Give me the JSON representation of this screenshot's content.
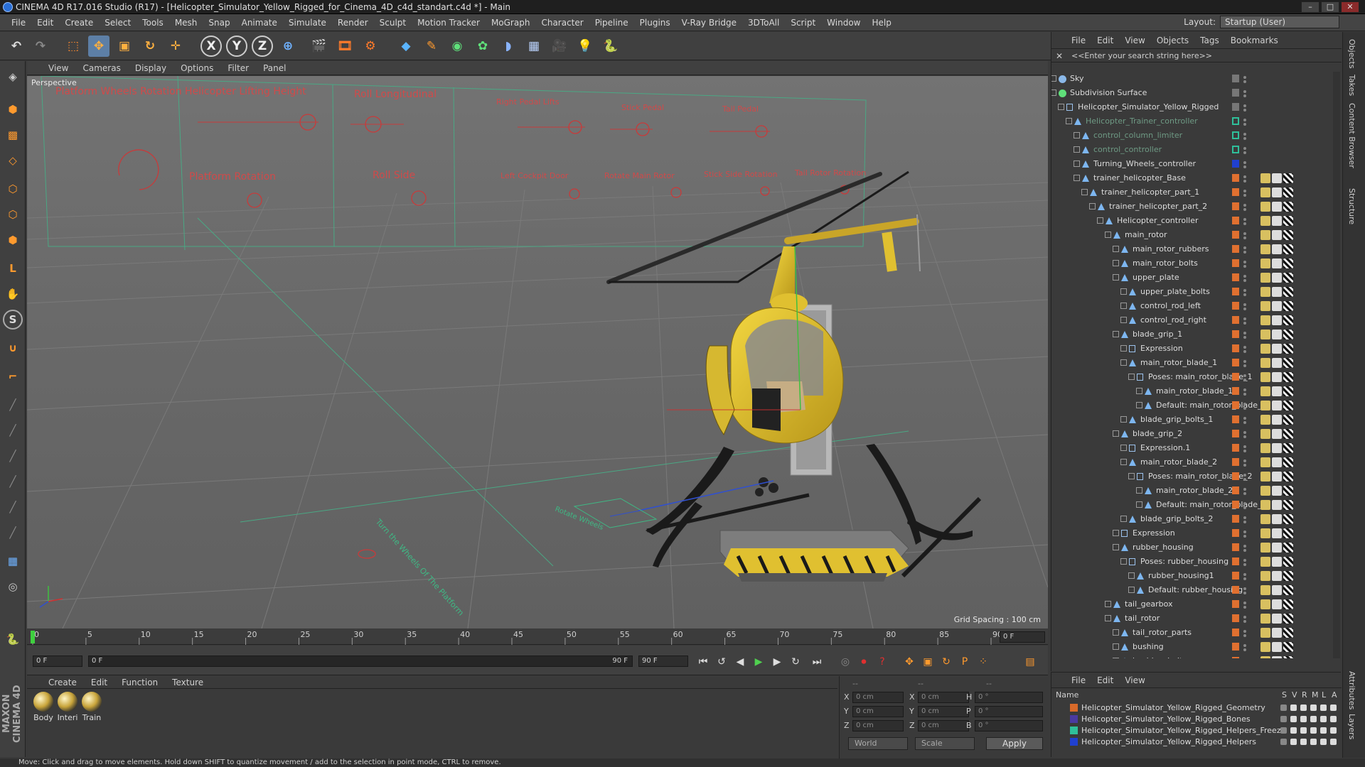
{
  "window": {
    "title": "CINEMA 4D R17.016 Studio (R17) - [Helicopter_Simulator_Yellow_Rigged_for_Cinema_4D_c4d_standart.c4d *] - Main"
  },
  "menu": [
    "File",
    "Edit",
    "Create",
    "Select",
    "Tools",
    "Mesh",
    "Snap",
    "Animate",
    "Simulate",
    "Render",
    "Sculpt",
    "Motion Tracker",
    "MoGraph",
    "Character",
    "Pipeline",
    "Plugins",
    "V-Ray Bridge",
    "3DToAll",
    "Script",
    "Window",
    "Help"
  ],
  "layout": {
    "label": "Layout:",
    "value": "Startup (User)"
  },
  "toolbar": {
    "axis_x": "X",
    "axis_y": "Y",
    "axis_z": "Z"
  },
  "viewport": {
    "menu": [
      "View",
      "Cameras",
      "Display",
      "Options",
      "Filter",
      "Panel"
    ],
    "label": "Perspective",
    "grid_spacing": "Grid Spacing : 100 cm",
    "hud": {
      "platform_wheels_rotation": "Platform Wheels Rotation",
      "lifting_height": "Helicopter Lifting Height",
      "roll_longitudinal": "Roll Longitudinal",
      "right_pedal": "Right Pedal Lifts",
      "stick_pedal": "Stick Pedal",
      "tail_pedal": "Tail Pedal",
      "platform_rotation": "Platform Rotation",
      "roll_side": "Roll Side",
      "left_cockpit_door": "Left Cockpit Door",
      "right_cockpit_door": "Rotate Main Rotor",
      "stick_side_rotation": "Stick Side Rotation",
      "tail_rotor_rotation": "Tail Rotor Rotation",
      "turn_wheels": "Turn the Wheels Of The Platform",
      "control_wheels": "Rotate Wheels"
    }
  },
  "timeline": {
    "ticks": [
      "0",
      "5",
      "10",
      "15",
      "20",
      "25",
      "30",
      "35",
      "40",
      "45",
      "50",
      "55",
      "60",
      "65",
      "70",
      "75",
      "80",
      "85",
      "90"
    ],
    "current_frame_right": "0 F"
  },
  "playback": {
    "start": "0 F",
    "slider_start": "0 F",
    "slider_end": "90 F",
    "end": "90 F"
  },
  "materials": {
    "menu": [
      "Create",
      "Edit",
      "Function",
      "Texture"
    ],
    "items": [
      "Body",
      "Interi",
      "Train"
    ]
  },
  "coords": {
    "header": "--",
    "rows": [
      {
        "a_label": "X",
        "a_val": "0 cm",
        "b_label": "X",
        "b_val": "0 cm",
        "c_label": "H",
        "c_val": "0 °"
      },
      {
        "a_label": "Y",
        "a_val": "0 cm",
        "b_label": "Y",
        "b_val": "0 cm",
        "c_label": "P",
        "c_val": "0 °"
      },
      {
        "a_label": "Z",
        "a_val": "0 cm",
        "b_label": "Z",
        "b_val": "0 cm",
        "c_label": "B",
        "c_val": "0 °"
      }
    ],
    "world": "World",
    "scale": "Scale",
    "apply": "Apply"
  },
  "status": "Move: Click and drag to move elements. Hold down SHIFT to quantize movement / add to the selection in point mode, CTRL to remove.",
  "objects": {
    "menu": [
      "File",
      "Edit",
      "View",
      "Objects",
      "Tags",
      "Bookmarks"
    ],
    "search": "<<Enter your search string here>>",
    "tree": [
      {
        "label": "Sky",
        "depth": 0,
        "icon": "sky-icon"
      },
      {
        "label": "Subdivision Surface",
        "depth": 0,
        "icon": "subdivision-icon"
      },
      {
        "label": "Helicopter_Simulator_Yellow_Rigged",
        "depth": 1,
        "icon": "null-icon"
      },
      {
        "label": "Helicopter_Trainer_controller",
        "depth": 2,
        "icon": "joint-icon",
        "dim": true
      },
      {
        "label": "control_column_limiter",
        "depth": 3,
        "icon": "joint-icon",
        "dim": true
      },
      {
        "label": "control_controller",
        "depth": 3,
        "icon": "joint-icon",
        "dim": true
      },
      {
        "label": "Turning_Wheels_controller",
        "depth": 3,
        "icon": "joint-icon"
      },
      {
        "label": "trainer_helicopter_Base",
        "depth": 3,
        "icon": "joint-icon"
      },
      {
        "label": "trainer_helicopter_part_1",
        "depth": 4,
        "icon": "joint-icon"
      },
      {
        "label": "trainer_helicopter_part_2",
        "depth": 5,
        "icon": "joint-icon"
      },
      {
        "label": "Helicopter_controller",
        "depth": 6,
        "icon": "joint-icon"
      },
      {
        "label": "main_rotor",
        "depth": 7,
        "icon": "joint-icon"
      },
      {
        "label": "main_rotor_rubbers",
        "depth": 8,
        "icon": "joint-icon"
      },
      {
        "label": "main_rotor_bolts",
        "depth": 8,
        "icon": "joint-icon"
      },
      {
        "label": "upper_plate",
        "depth": 8,
        "icon": "joint-icon"
      },
      {
        "label": "upper_plate_bolts",
        "depth": 9,
        "icon": "joint-icon"
      },
      {
        "label": "control_rod_left",
        "depth": 9,
        "icon": "joint-icon"
      },
      {
        "label": "control_rod_right",
        "depth": 9,
        "icon": "joint-icon"
      },
      {
        "label": "blade_grip_1",
        "depth": 8,
        "icon": "joint-icon"
      },
      {
        "label": "Expression",
        "depth": 9,
        "icon": "null-icon"
      },
      {
        "label": "main_rotor_blade_1",
        "depth": 9,
        "icon": "joint-icon"
      },
      {
        "label": "Poses: main_rotor_blade_1",
        "depth": 10,
        "icon": "null-icon"
      },
      {
        "label": "main_rotor_blade_11",
        "depth": 11,
        "icon": "joint-icon"
      },
      {
        "label": "Default: main_rotor_blade_1",
        "depth": 11,
        "icon": "joint-icon"
      },
      {
        "label": "blade_grip_bolts_1",
        "depth": 9,
        "icon": "joint-icon"
      },
      {
        "label": "blade_grip_2",
        "depth": 8,
        "icon": "joint-icon"
      },
      {
        "label": "Expression.1",
        "depth": 9,
        "icon": "null-icon"
      },
      {
        "label": "main_rotor_blade_2",
        "depth": 9,
        "icon": "joint-icon"
      },
      {
        "label": "Poses: main_rotor_blade_2",
        "depth": 10,
        "icon": "null-icon"
      },
      {
        "label": "main_rotor_blade_21",
        "depth": 11,
        "icon": "joint-icon"
      },
      {
        "label": "Default: main_rotor_blade_2",
        "depth": 11,
        "icon": "joint-icon"
      },
      {
        "label": "blade_grip_bolts_2",
        "depth": 9,
        "icon": "joint-icon"
      },
      {
        "label": "Expression",
        "depth": 8,
        "icon": "null-icon"
      },
      {
        "label": "rubber_housing",
        "depth": 8,
        "icon": "joint-icon"
      },
      {
        "label": "Poses: rubber_housing",
        "depth": 9,
        "icon": "null-icon"
      },
      {
        "label": "rubber_housing1",
        "depth": 10,
        "icon": "joint-icon"
      },
      {
        "label": "Default: rubber_housing",
        "depth": 10,
        "icon": "joint-icon"
      },
      {
        "label": "tail_gearbox",
        "depth": 7,
        "icon": "joint-icon"
      },
      {
        "label": "tail_rotor",
        "depth": 7,
        "icon": "joint-icon"
      },
      {
        "label": "tail_rotor_parts",
        "depth": 8,
        "icon": "joint-icon"
      },
      {
        "label": "bushing",
        "depth": 8,
        "icon": "joint-icon"
      },
      {
        "label": "bushing_bolts",
        "depth": 8,
        "icon": "joint-icon"
      }
    ]
  },
  "layers": {
    "menu": [
      "File",
      "Edit",
      "View"
    ],
    "header": {
      "name": "Name",
      "s": "S",
      "v": "V",
      "r": "R",
      "m": "M",
      "l": "L",
      "a": "A"
    },
    "items": [
      {
        "label": "Helicopter_Simulator_Yellow_Rigged_Geometry",
        "color": "#d86a2a"
      },
      {
        "label": "Helicopter_Simulator_Yellow_Rigged_Bones",
        "color": "#4a3aa0"
      },
      {
        "label": "Helicopter_Simulator_Yellow_Rigged_Helpers_Freeze",
        "color": "#2fbf9a"
      },
      {
        "label": "Helicopter_Simulator_Yellow_Rigged_Helpers",
        "color": "#2040d0"
      }
    ]
  },
  "right_tabs": [
    "Objects",
    "Takes",
    "Content Browser",
    "Structure",
    "Attributes",
    "Layers"
  ]
}
